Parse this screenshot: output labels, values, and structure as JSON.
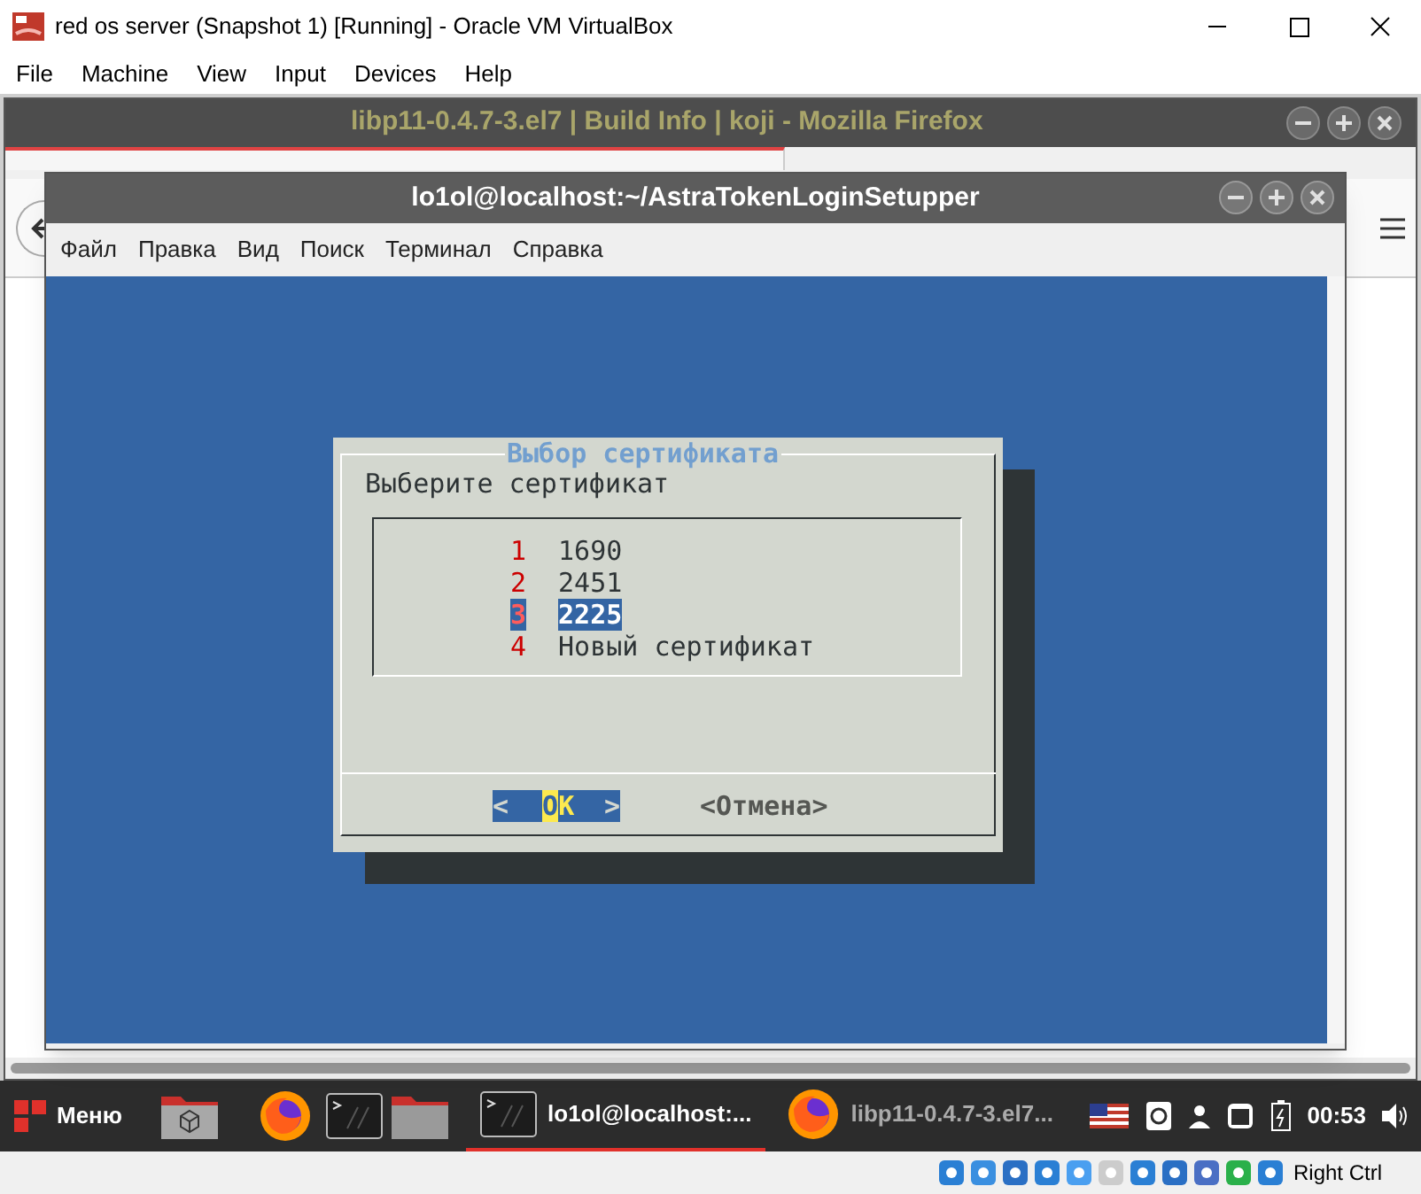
{
  "vbox": {
    "title": "red os server (Snapshot 1) [Running] - Oracle VM VirtualBox",
    "menu": [
      "File",
      "Machine",
      "View",
      "Input",
      "Devices",
      "Help"
    ],
    "host_key": "Right Ctrl"
  },
  "firefox": {
    "title": "libp11-0.4.7-3.el7 | Build Info | koji - Mozilla Firefox"
  },
  "terminal": {
    "title": "lo1ol@localhost:~/AstraTokenLoginSetupper",
    "menu": [
      "Файл",
      "Правка",
      "Вид",
      "Поиск",
      "Терминал",
      "Справка"
    ]
  },
  "dialog": {
    "title": "Выбор сертификата",
    "prompt": "Выберите сертификат",
    "items": [
      {
        "tag": "1",
        "text": "1690",
        "selected": false
      },
      {
        "tag": "2",
        "text": "2451",
        "selected": false
      },
      {
        "tag": "3",
        "text": "2225",
        "selected": true
      },
      {
        "tag": "4",
        "text": "Новый сертификат",
        "selected": false
      }
    ],
    "buttons": [
      {
        "open": "<",
        "label": "OK",
        "close": ">",
        "selected": true
      },
      {
        "open": "<",
        "label": "Отмена",
        "close": ">",
        "selected": false
      }
    ]
  },
  "taskbar": {
    "menu_label": "Меню",
    "tasks": [
      {
        "kind": "terminal",
        "label": "lo1ol@localhost:...",
        "selected": true
      },
      {
        "kind": "firefox",
        "label": "libp11-0.4.7-3.el7...",
        "selected": false
      }
    ],
    "clock": "00:53"
  }
}
